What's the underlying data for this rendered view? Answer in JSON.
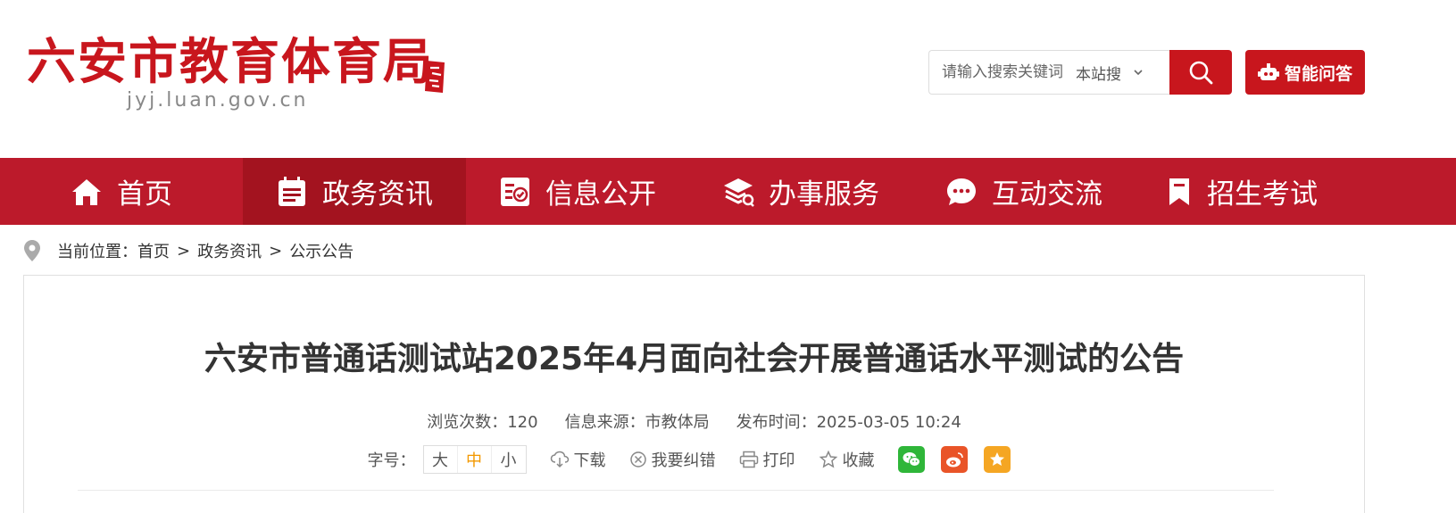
{
  "header": {
    "logo_title": "六安市教育体育局",
    "logo_domain": "jyj.luan.gov.cn",
    "search_placeholder": "请输入搜索关键词",
    "site_select": "本站搜",
    "ai_button": "智能问答",
    "brand_color": "#c8161d"
  },
  "nav": {
    "items": [
      {
        "label": "首页",
        "icon": "home-icon"
      },
      {
        "label": "政务资讯",
        "icon": "calendar-list-icon"
      },
      {
        "label": "信息公开",
        "icon": "document-check-icon"
      },
      {
        "label": "办事服务",
        "icon": "stack-service-icon"
      },
      {
        "label": "互动交流",
        "icon": "chat-bubble-icon"
      },
      {
        "label": "招生考试",
        "icon": "bookmark-icon"
      }
    ],
    "active_index": 1,
    "bg_color": "#bc1a2b",
    "active_color": "#a3131f"
  },
  "breadcrumb": {
    "prefix": "当前位置：",
    "items": [
      "首页",
      "政务资讯",
      "公示公告"
    ],
    "separator": ">"
  },
  "article": {
    "title": "六安市普通话测试站2025年4月面向社会开展普通话水平测试的公告",
    "views": "浏览次数：120",
    "source": "信息来源：市教体局",
    "published": "发布时间：2025-03-05 10:24",
    "font_size_label": "字号：",
    "font_sizes": [
      "大",
      "中",
      "小"
    ],
    "download": "下载",
    "report_error": "我要纠错",
    "print": "打印",
    "favorite": "收藏"
  }
}
